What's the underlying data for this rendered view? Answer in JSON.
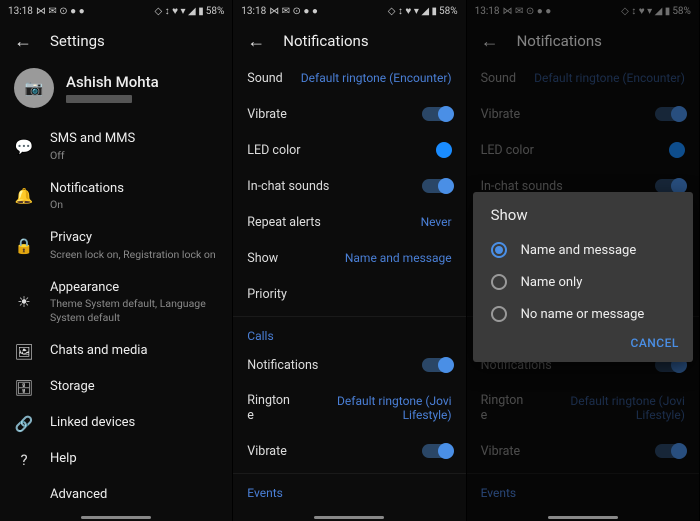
{
  "status": {
    "time": "13:18",
    "icons_left": "⋈ ✉ ⊙ ● ●",
    "icons_right": "◇ ↕ ♥ ▾ ◢ ▮",
    "battery": "58%"
  },
  "s1": {
    "title": "Settings",
    "profile": {
      "name": "Ashish Mohta"
    },
    "items": [
      {
        "icon": "💬",
        "title": "SMS and MMS",
        "sub": "Off"
      },
      {
        "icon": "🔔",
        "title": "Notifications",
        "sub": "On"
      },
      {
        "icon": "🔒",
        "title": "Privacy",
        "sub": "Screen lock on, Registration lock on"
      },
      {
        "icon": "☀",
        "title": "Appearance",
        "sub": "Theme System default, Language System default"
      },
      {
        "icon": "🖼",
        "title": "Chats and media",
        "sub": ""
      },
      {
        "icon": "🗄",
        "title": "Storage",
        "sub": ""
      },
      {
        "icon": "🔗",
        "title": "Linked devices",
        "sub": ""
      },
      {
        "icon": "?",
        "title": "Help",
        "sub": ""
      },
      {
        "icon": "</>",
        "title": "Advanced",
        "sub": ""
      }
    ]
  },
  "s2": {
    "title": "Notifications",
    "rows": [
      {
        "label": "Sound",
        "value": "Default ringtone (Encounter)",
        "type": "link"
      },
      {
        "label": "Vibrate",
        "type": "toggle"
      },
      {
        "label": "LED color",
        "type": "led"
      },
      {
        "label": "In-chat sounds",
        "type": "toggle"
      },
      {
        "label": "Repeat alerts",
        "value": "Never",
        "type": "link"
      },
      {
        "label": "Show",
        "value": "Name and message",
        "type": "link"
      },
      {
        "label": "Priority",
        "type": "plain"
      }
    ],
    "calls_header": "Calls",
    "calls": [
      {
        "label": "Notifications",
        "type": "toggle"
      },
      {
        "label": "Ringtone",
        "value": "Default ringtone (Jovi Lifestyle)",
        "type": "link"
      },
      {
        "label": "Vibrate",
        "type": "toggle"
      }
    ],
    "events_header": "Events"
  },
  "dialog": {
    "title": "Show",
    "options": [
      "Name and message",
      "Name only",
      "No name or message"
    ],
    "selected": 0,
    "cancel": "CANCEL"
  }
}
